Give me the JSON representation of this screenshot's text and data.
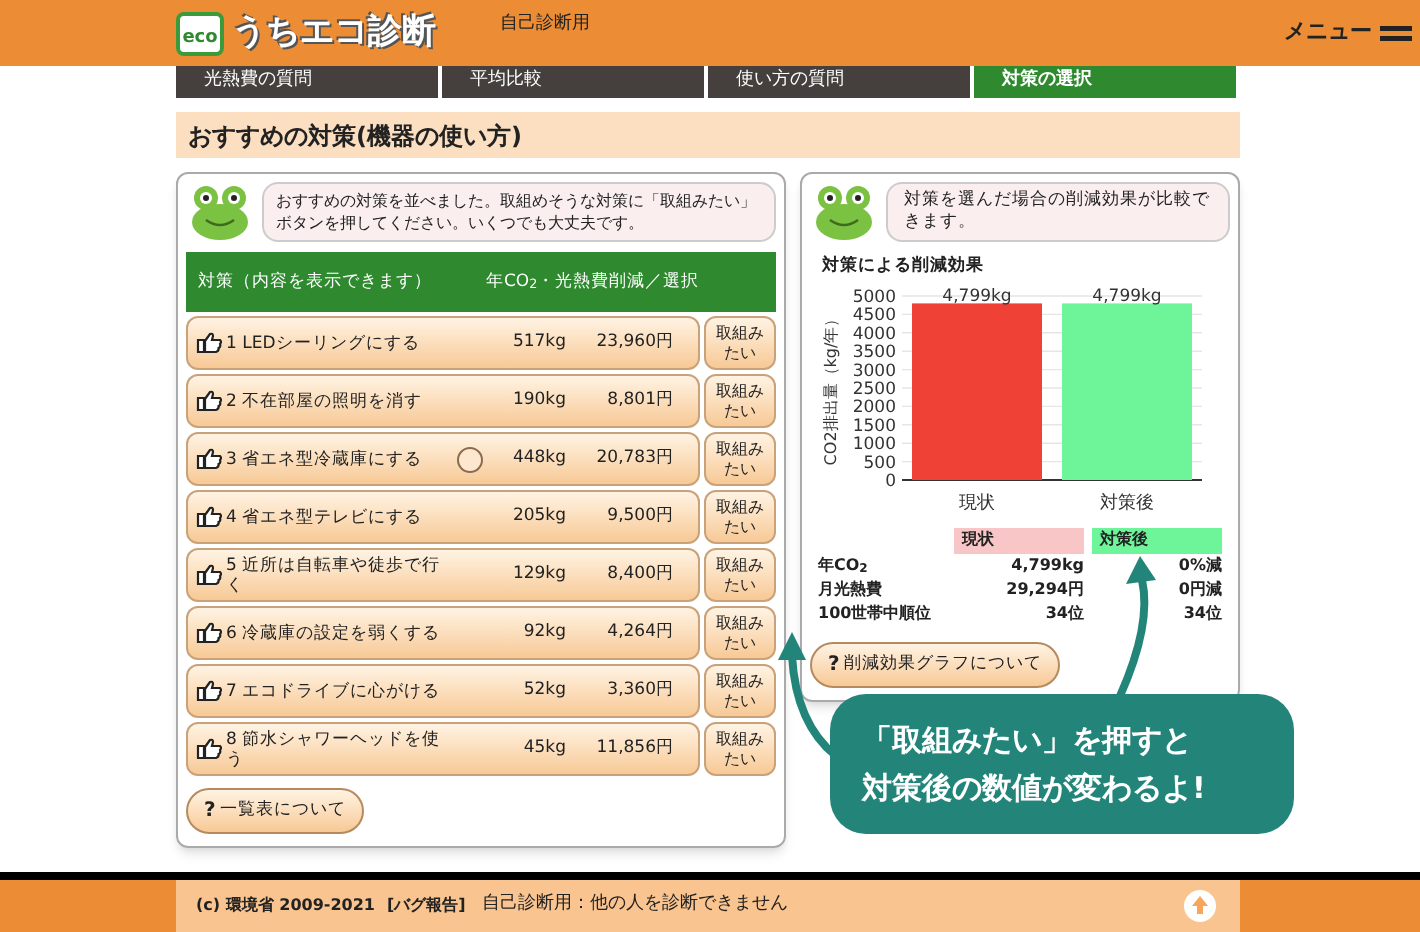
{
  "header": {
    "logo_badge": "eco",
    "logo_text": "うちエコ診断",
    "mode": "自己診断用",
    "menu": "メニュー"
  },
  "steps": [
    {
      "label": "光熱費の質問",
      "selected": false
    },
    {
      "label": "平均比較",
      "selected": false
    },
    {
      "label": "使い方の質問",
      "selected": false
    },
    {
      "label": "対策の選択",
      "selected": true
    }
  ],
  "page_title": "おすすめの対策(機器の使い方)",
  "left_panel": {
    "message": "おすすめの対策を並べました。取組めそうな対策に「取組みたい」ボタンを押してください。いくつでも大丈夫です。",
    "columns": [
      "対策（内容を表示できます）",
      "年CO$_{2}$・光熱費削減／選択"
    ],
    "rows": [
      {
        "label": "1 LEDシーリングにする",
        "co2": "517kg",
        "cost": "23,960円",
        "button": "取組みたい",
        "badge": false
      },
      {
        "label": "2 不在部屋の照明を消す",
        "co2": "190kg",
        "cost": "8,801円",
        "button": "取組みたい",
        "badge": false
      },
      {
        "label": "3 省エネ型冷蔵庫にする",
        "co2": "448kg",
        "cost": "20,783円",
        "button": "取組みたい",
        "badge": true
      },
      {
        "label": "4 省エネ型テレビにする",
        "co2": "205kg",
        "cost": "9,500円",
        "button": "取組みたい",
        "badge": false
      },
      {
        "label": "5 近所は自転車や徒歩で行く",
        "co2": "129kg",
        "cost": "8,400円",
        "button": "取組みたい",
        "badge": false
      },
      {
        "label": "6 冷蔵庫の設定を弱くする",
        "co2": "92kg",
        "cost": "4,264円",
        "button": "取組みたい",
        "badge": false
      },
      {
        "label": "7 エコドライブに心がける",
        "co2": "52kg",
        "cost": "3,360円",
        "button": "取組みたい",
        "badge": false
      },
      {
        "label": "8 節水シャワーヘッドを使う",
        "co2": "45kg",
        "cost": "11,856円",
        "button": "取組みたい",
        "badge": false
      }
    ],
    "help_button": {
      "icon": "?",
      "label": "一覧表について"
    }
  },
  "right_panel": {
    "message": "対策を選んだ場合の削減効果が比較できます。",
    "chart_title": "対策による削減効果",
    "chart_data": {
      "type": "bar",
      "ylabel": "CO2排出量（kg/年）",
      "categories": [
        "現状",
        "対策後"
      ],
      "values": [
        4799,
        4799
      ],
      "grid": true,
      "colors": [
        "#ef4136",
        "#6ef59a"
      ],
      "value_labels": [
        "4,799kg",
        "4,799kg"
      ],
      "ylim": [
        0,
        5000
      ],
      "yticks": [
        0,
        500,
        1000,
        1500,
        2000,
        2500,
        3000,
        3500,
        4000,
        4500,
        5000
      ]
    },
    "table_columns": [
      {
        "label": "現状",
        "color": "#f8c6c6"
      },
      {
        "label": "対策後",
        "color": "#6ef59a"
      }
    ],
    "table_rows": [
      {
        "label": "年CO$_{2}$",
        "current": "4,799kg",
        "after": "0%減"
      },
      {
        "label": "月光熱費",
        "current": "29,294円",
        "after": "0円減"
      },
      {
        "label": "100世帯中順位",
        "current": "34位",
        "after": "34位"
      }
    ],
    "help_button": {
      "icon": "?",
      "label": "削減効果グラフについて"
    }
  },
  "callout": {
    "lines": [
      "「取組みたい」を押すと",
      "対策後の数値が変わるよ!"
    ]
  },
  "footer": {
    "copyright": "(c) 環境省 2009-2021",
    "bug_report": "[バグ報告]",
    "notice": "自己診断用：他の人を診断できません"
  }
}
